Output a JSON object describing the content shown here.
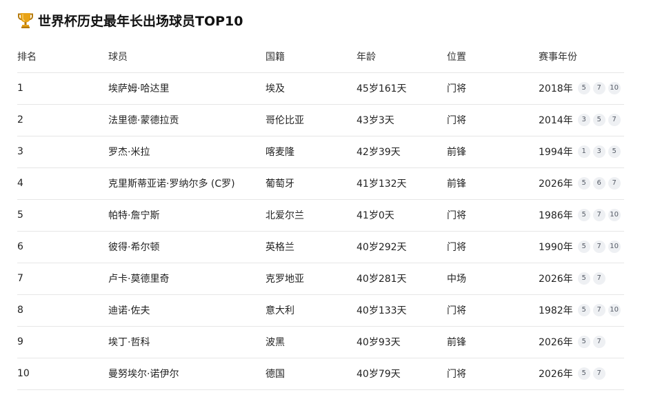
{
  "title": "世界杯历史最年长出场球员TOP10",
  "icons": {
    "trophy": "trophy-icon"
  },
  "colors": {
    "trophy": "#e8a317",
    "trophy_dark": "#b57a0c",
    "divider": "#e6e6e6",
    "badge_bg": "#eef0f3"
  },
  "table": {
    "headers": [
      "排名",
      "球员",
      "国籍",
      "年龄",
      "位置",
      "赛事年份"
    ],
    "rows": [
      {
        "rank": "1",
        "player": "埃萨姆·哈达里",
        "nationality": "埃及",
        "age": "45岁161天",
        "position": "门将",
        "year": "2018年",
        "badges": [
          "5",
          "7",
          "10"
        ]
      },
      {
        "rank": "2",
        "player": "法里德·蒙德拉贡",
        "nationality": "哥伦比亚",
        "age": "43岁3天",
        "position": "门将",
        "year": "2014年",
        "badges": [
          "3",
          "5",
          "7"
        ]
      },
      {
        "rank": "3",
        "player": "罗杰·米拉",
        "nationality": "喀麦隆",
        "age": "42岁39天",
        "position": "前锋",
        "year": "1994年",
        "badges": [
          "1",
          "3",
          "5"
        ]
      },
      {
        "rank": "4",
        "player": "克里斯蒂亚诺·罗纳尔多 (C罗)",
        "nationality": "葡萄牙",
        "age": "41岁132天",
        "position": "前锋",
        "year": "2026年",
        "badges": [
          "5",
          "6",
          "7"
        ]
      },
      {
        "rank": "5",
        "player": "帕特·詹宁斯",
        "nationality": "北爱尔兰",
        "age": "41岁0天",
        "position": "门将",
        "year": "1986年",
        "badges": [
          "5",
          "7",
          "10"
        ]
      },
      {
        "rank": "6",
        "player": "彼得·希尔顿",
        "nationality": "英格兰",
        "age": "40岁292天",
        "position": "门将",
        "year": "1990年",
        "badges": [
          "5",
          "7",
          "10"
        ]
      },
      {
        "rank": "7",
        "player": "卢卡·莫德里奇",
        "nationality": "克罗地亚",
        "age": "40岁281天",
        "position": "中场",
        "year": "2026年",
        "badges": [
          "5",
          "7"
        ]
      },
      {
        "rank": "8",
        "player": "迪诺·佐夫",
        "nationality": "意大利",
        "age": "40岁133天",
        "position": "门将",
        "year": "1982年",
        "badges": [
          "5",
          "7",
          "10"
        ]
      },
      {
        "rank": "9",
        "player": "埃丁·哲科",
        "nationality": "波黑",
        "age": "40岁93天",
        "position": "前锋",
        "year": "2026年",
        "badges": [
          "5",
          "7"
        ]
      },
      {
        "rank": "10",
        "player": "曼努埃尔·诺伊尔",
        "nationality": "德国",
        "age": "40岁79天",
        "position": "门将",
        "year": "2026年",
        "badges": [
          "5",
          "7"
        ]
      }
    ]
  }
}
